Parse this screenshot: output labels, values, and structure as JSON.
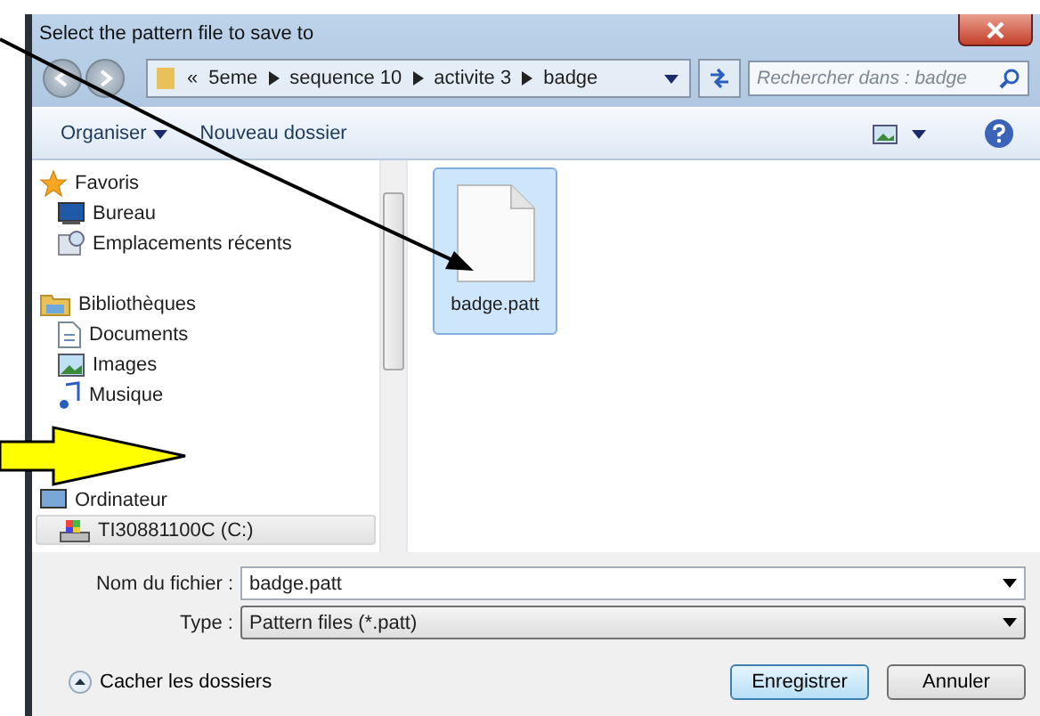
{
  "window": {
    "title": "Select the pattern file to save to"
  },
  "address_bar": {
    "overflow": "«",
    "crumbs": [
      "5eme",
      "sequence 10",
      "activite 3",
      "badge"
    ]
  },
  "search": {
    "placeholder": "Rechercher dans : badge"
  },
  "toolbar": {
    "items": [
      "Organiser",
      "Nouveau dossier"
    ]
  },
  "navigation": [
    {
      "label": "Favoris",
      "kind": "star",
      "selected": false,
      "children": [
        {
          "label": "Bureau",
          "kind": "desktop",
          "selected": false
        },
        {
          "label": "Emplacements récents",
          "kind": "recent",
          "selected": false
        }
      ]
    },
    {
      "label": "Bibliothèques",
      "kind": "library",
      "selected": false,
      "children": [
        {
          "label": "Documents",
          "kind": "document",
          "selected": false
        },
        {
          "label": "Images",
          "kind": "image",
          "selected": false
        },
        {
          "label": "Musique",
          "kind": "music",
          "selected": false
        }
      ]
    },
    {
      "label": "Ordinateur",
      "kind": "computer",
      "selected": false,
      "children": [
        {
          "label": "TI30881100C (C:)",
          "kind": "drive",
          "selected": true
        }
      ]
    }
  ],
  "files": [
    {
      "name": "badge.patt",
      "selected": true
    }
  ],
  "form": {
    "filename_label": "Nom du fichier :",
    "filename": "badge.patt",
    "type_label": "Type :",
    "type": "Pattern files (*.patt)"
  },
  "hide_folders": "Cacher les dossiers",
  "buttons": [
    "Enregistrer",
    "Annuler"
  ]
}
